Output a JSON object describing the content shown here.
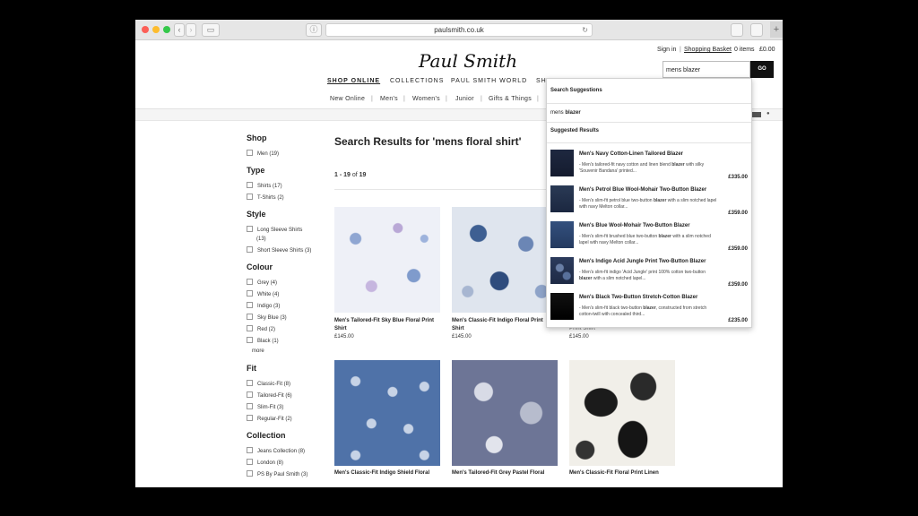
{
  "browser": {
    "url": "paulsmith.co.uk",
    "plus_label": "+"
  },
  "header": {
    "logo": "Paul Smith",
    "sign_in": "Sign in",
    "separator": "|",
    "basket": "Shopping Basket",
    "items": "0 items",
    "total": "£0.00",
    "search_value": "mens blazer",
    "go_label": "GO"
  },
  "main_nav": [
    "SHOP ONLINE",
    "COLLECTIONS",
    "PAUL SMITH WORLD",
    "SH"
  ],
  "sub_nav": [
    "New Online",
    "|",
    "Men's",
    "|",
    "Women's",
    "|",
    "Junior",
    "|",
    "Gifts & Things",
    "|"
  ],
  "filters": {
    "shop": {
      "heading": "Shop",
      "options": [
        "Men (19)"
      ]
    },
    "type": {
      "heading": "Type",
      "options": [
        "Shirts (17)",
        "T-Shirts (2)"
      ]
    },
    "style": {
      "heading": "Style",
      "options": [
        "Long Sleeve Shirts",
        "(13)",
        "Short Sleeve Shirts (3)"
      ]
    },
    "colour": {
      "heading": "Colour",
      "options": [
        "Grey (4)",
        "White (4)",
        "Indigo (3)",
        "Sky Blue (3)",
        "Red (2)",
        "Black (1)"
      ],
      "more": "more"
    },
    "fit": {
      "heading": "Fit",
      "options": [
        "Classic-Fit (8)",
        "Tailored-Fit (6)",
        "Slim-Fit (3)",
        "Regular-Fit (2)"
      ]
    },
    "collection": {
      "heading": "Collection",
      "options": [
        "Jeans Collection (8)",
        "London (8)",
        "PS By Paul Smith (3)"
      ]
    }
  },
  "results": {
    "title": "Search Results for 'mens floral shirt'",
    "count_range": "1 - 19",
    "count_of": "of",
    "count_total": "19",
    "products": [
      {
        "name": "Men's Tailored-Fit Sky Blue Floral Print Shirt",
        "price": "£145.00"
      },
      {
        "name": "Men's Classic-Fit Indigo Floral Print Shirt",
        "price": "£145.00"
      },
      {
        "name": "Print Shirt",
        "price": "£145.00"
      },
      {
        "name": "Men's Classic-Fit Indigo Shield Floral",
        "price": ""
      },
      {
        "name": "Men's Tailored-Fit Grey Pastel Floral",
        "price": ""
      },
      {
        "name": "Men's Classic-Fit Floral Print Linen",
        "price": ""
      }
    ]
  },
  "suggestions": {
    "heading": "Search Suggestions",
    "term_prefix": "mens ",
    "term_bold": "blazer",
    "results_heading": "Suggested Results",
    "items": [
      {
        "name_pre": "Men's Navy Cotton-Linen Tailored ",
        "name_bold": "Blazer",
        "desc_pre": "- Men's tailored-fit navy cotton and linen blend ",
        "desc_bold": "blazer",
        "desc_post": " with silky 'Souvenir Bandana' printed...",
        "price": "£335.00"
      },
      {
        "name_pre": "Men's Petrol Blue Wool-Mohair Two-Button ",
        "name_bold": "Blazer",
        "desc_pre": "- Men's slim-fit petrol blue two-button ",
        "desc_bold": "blazer",
        "desc_post": " with a slim notched lapel with navy Melton collar...",
        "price": "£359.00"
      },
      {
        "name_pre": "Men's Blue Wool-Mohair Two-Button ",
        "name_bold": "Blazer",
        "desc_pre": "- Men's slim-fit brushed blue two-button ",
        "desc_bold": "blazer",
        "desc_post": " with a slim notched lapel with navy Melton collar...",
        "price": "£359.00"
      },
      {
        "name_pre": "Men's Indigo Acid Jungle Print Two-Button ",
        "name_bold": "Blazer",
        "desc_pre": "- Men's slim-fit indigo 'Acid Jungle' print 100% cotton two-button ",
        "desc_bold": "blazer",
        "desc_post": " with a slim notched lapel...",
        "price": "£359.00"
      },
      {
        "name_pre": "Men's Black Two-Button Stretch-Cotton ",
        "name_bold": "Blazer",
        "desc_pre": "- Men's slim-fit black two-button ",
        "desc_bold": "blazer",
        "desc_post": ", constructed from stretch cotton-twill with concealed third...",
        "price": "£235.00"
      }
    ]
  },
  "colors": {
    "traffic_red": "#fc5f57",
    "traffic_yellow": "#fdbc2e",
    "traffic_green": "#34c84a",
    "accent": "#111111"
  }
}
